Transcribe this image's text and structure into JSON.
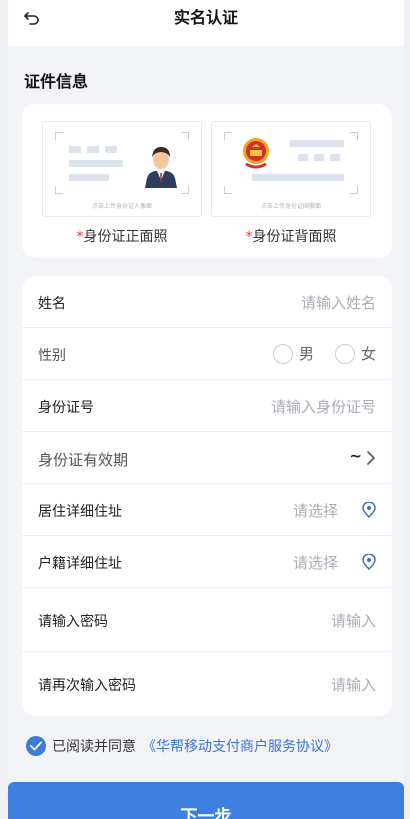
{
  "header": {
    "title": "实名认证"
  },
  "section": {
    "title": "证件信息"
  },
  "id_cards": {
    "hint": "点击上传身份证人像面",
    "back_hint": "点击上传身份证国徽面",
    "front_label": "身份证正面照",
    "back_label": "身份证背面照",
    "required_mark": "*"
  },
  "form": {
    "name_label": "姓名",
    "name_placeholder": "请输入姓名",
    "gender_label": "性别",
    "gender_male": "男",
    "gender_female": "女",
    "id_label": "身份证号",
    "id_placeholder": "请输入身份证号",
    "validity_label": "身份证有效期",
    "validity_value": "~",
    "residence_label": "居住详细住址",
    "residence_placeholder": "请选择",
    "household_label": "户籍详细住址",
    "household_placeholder": "请选择",
    "password_label": "请输入密码",
    "password_placeholder": "请输入",
    "password2_label": "请再次输入密码",
    "password2_placeholder": "请输入"
  },
  "agreement": {
    "text": "已阅读并同意",
    "link": "《华帮移动支付商户服务协议》"
  },
  "next_button": "下一步",
  "colors": {
    "accent": "#3f7fe0",
    "required": "#e53935",
    "link": "#3a72d6"
  }
}
